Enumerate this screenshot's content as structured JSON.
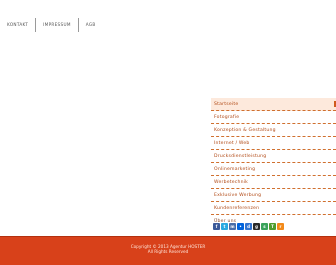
{
  "nav": {
    "links": [
      "Kontakt",
      "Impressum",
      "AGB"
    ]
  },
  "menu": {
    "items": [
      "Startseite",
      "Fotografie",
      "Konzeption & Gestaltung",
      "Internet / Web",
      "Drucksdienstleistung",
      "Onlinemarketing",
      "Werbetechnik",
      "Exklusive Werbung",
      "Kundenreferenzen",
      "Über uns"
    ]
  },
  "social": {
    "icons": [
      {
        "name": "facebook-icon",
        "glyph": "f",
        "color": "#3b5998"
      },
      {
        "name": "twitter-icon",
        "glyph": "t",
        "color": "#2aa9e0"
      },
      {
        "name": "myspace-icon",
        "glyph": "m",
        "color": "#4a6ea9"
      },
      {
        "name": "flickr-icon",
        "glyph": "•",
        "color": "#0063dc"
      },
      {
        "name": "delicious-icon",
        "glyph": "d",
        "color": "#3274d1"
      },
      {
        "name": "digg-icon",
        "glyph": "g",
        "color": "#2a2a2a"
      },
      {
        "name": "stumbleupon-icon",
        "glyph": "s",
        "color": "#3aa35b"
      },
      {
        "name": "technorati-icon",
        "glyph": "T",
        "color": "#4f9c2e"
      },
      {
        "name": "rss-icon",
        "glyph": "r",
        "color": "#f28a1a"
      }
    ]
  },
  "footer": {
    "line1": "Copyright © 2013 Agentur HOSTER",
    "line2": "All Rights Reserved"
  },
  "colors": {
    "footer_bg": "#d8411a",
    "accent": "#b14a16"
  }
}
